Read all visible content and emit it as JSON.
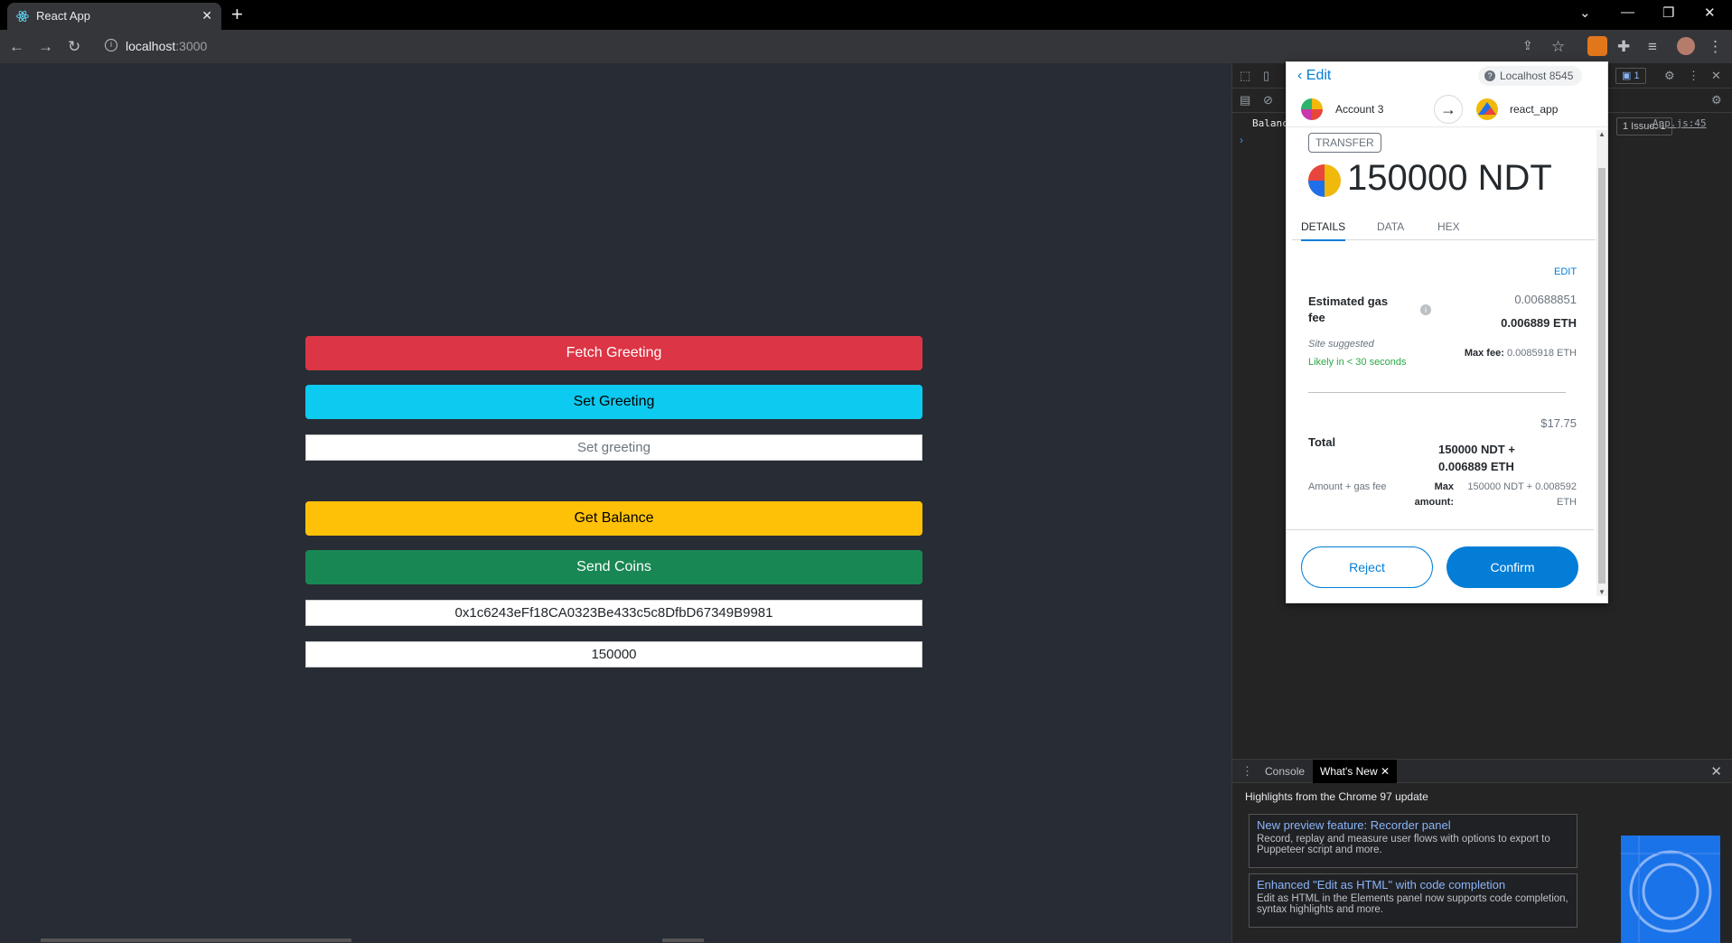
{
  "browser": {
    "tab_title": "React App",
    "url_host": "localhost",
    "url_port": ":3000"
  },
  "app": {
    "fetch_greeting_label": "Fetch Greeting",
    "set_greeting_label": "Set Greeting",
    "greeting_placeholder": "Set greeting",
    "get_balance_label": "Get Balance",
    "send_coins_label": "Send Coins",
    "address_value": "0x1c6243eFf18CA0323Be433c5c8DfbD67349B9981",
    "amount_value": "150000",
    "colors": {
      "fetch": "#dc3545",
      "set": "#0dcaf0",
      "balance": "#ffc107",
      "send": "#198754"
    }
  },
  "metamask": {
    "back_label": "Edit",
    "network": "Localhost 8545",
    "from_account": "Account 3",
    "to_account": "react_app",
    "transfer_badge": "TRANSFER",
    "amount": "150000 NDT",
    "tabs": [
      "DETAILS",
      "DATA",
      "HEX"
    ],
    "edit_link": "EDIT",
    "gas_label": "Estimated gas fee",
    "gas_secondary": "0.00688851",
    "gas_primary": "0.006889 ETH",
    "site_suggested": "Site suggested",
    "likely": "Likely in < 30 seconds",
    "max_fee_label": "Max fee:",
    "max_fee_value": "0.0085918 ETH",
    "total_usd": "$17.75",
    "total_label": "Total",
    "total_value": "150000 NDT + 0.006889 ETH",
    "amount_gas_label": "Amount + gas fee",
    "max_amount_label": "Max amount:",
    "max_amount_value": "150000 NDT + 0.008592 ETH",
    "reject_label": "Reject",
    "confirm_label": "Confirm",
    "accent": "#037dd6"
  },
  "devtools": {
    "console_text": "Balanc",
    "source_link": "App.js:45",
    "issues": "1 Issue: 1",
    "messages_count": "1",
    "drawer_console": "Console",
    "drawer_whatsnew": "What's New",
    "highlights": "Highlights from the Chrome 97 update",
    "news": [
      {
        "title": "New preview feature: Recorder panel",
        "desc": "Record, replay and measure user flows with options to export to Puppeteer script and more."
      },
      {
        "title": "Enhanced \"Edit as HTML\" with code completion",
        "desc": "Edit as HTML in the Elements panel now supports code completion, syntax highlights and more."
      }
    ]
  }
}
